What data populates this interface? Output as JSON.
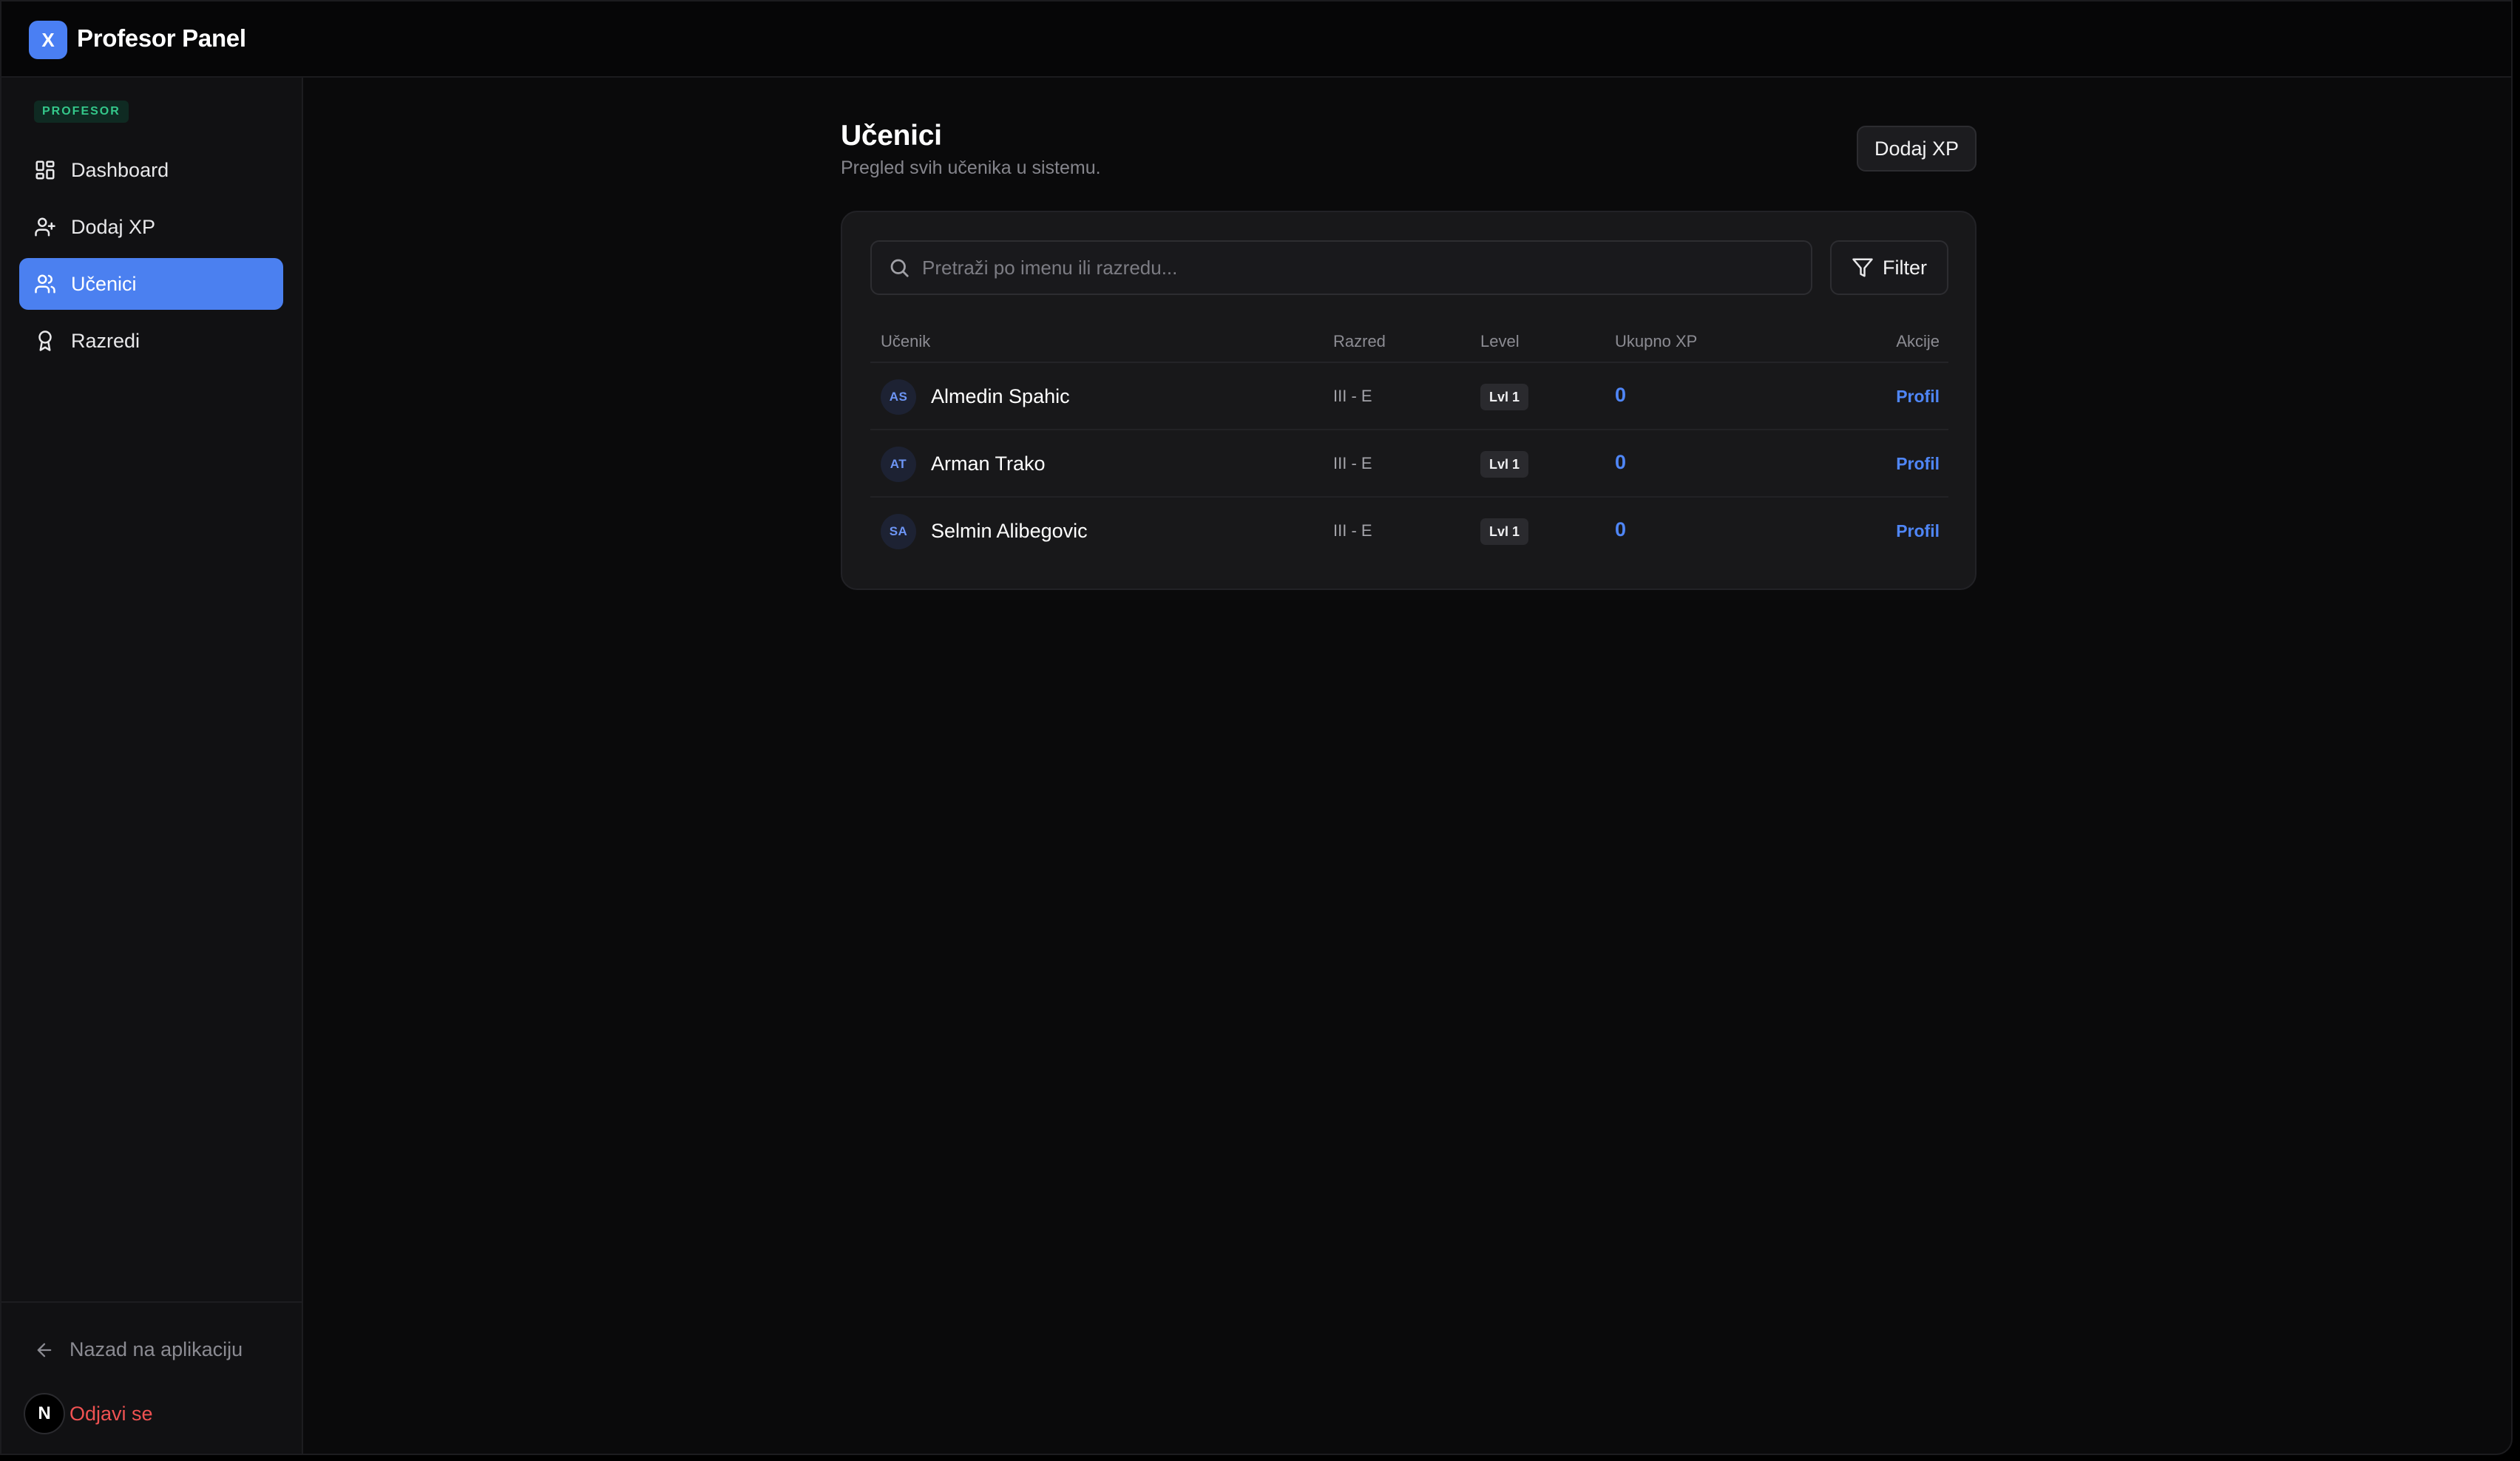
{
  "app": {
    "logo_letter": "X",
    "title": "Profesor Panel"
  },
  "sidebar": {
    "role_badge": "PROFESOR",
    "items": [
      {
        "label": "Dashboard",
        "icon": "dashboard-grid-icon",
        "active": false
      },
      {
        "label": "Dodaj XP",
        "icon": "user-plus-icon",
        "active": false
      },
      {
        "label": "Učenici",
        "icon": "users-icon",
        "active": true
      },
      {
        "label": "Razredi",
        "icon": "award-icon",
        "active": false
      }
    ],
    "back_label": "Nazad na aplikaciju",
    "logout_avatar": "N",
    "logout_label": "Odjavi se"
  },
  "main": {
    "title": "Učenici",
    "subtitle": "Pregled svih učenika u sistemu.",
    "add_xp_button": "Dodaj XP",
    "search_placeholder": "Pretraži po imenu ili razredu...",
    "filter_button": "Filter",
    "columns": [
      "Učenik",
      "Razred",
      "Level",
      "Ukupno XP",
      "Akcije"
    ],
    "students": [
      {
        "initials": "AS",
        "name": "Almedin Spahic",
        "class": "III - E",
        "level": "Lvl 1",
        "xp": "0",
        "action": "Profil"
      },
      {
        "initials": "AT",
        "name": "Arman Trako",
        "class": "III - E",
        "level": "Lvl 1",
        "xp": "0",
        "action": "Profil"
      },
      {
        "initials": "SA",
        "name": "Selmin Alibegovic",
        "class": "III - E",
        "level": "Lvl 1",
        "xp": "0",
        "action": "Profil"
      }
    ]
  },
  "colors": {
    "accent": "#4b80f0",
    "danger": "#f05252",
    "success": "#34c78a",
    "background": "#0a0a0b"
  }
}
